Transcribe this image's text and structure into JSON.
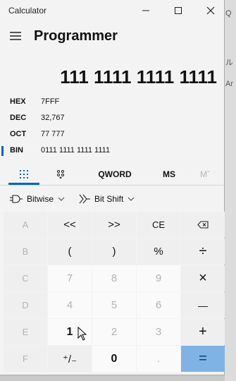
{
  "window": {
    "title": "Calculator"
  },
  "header": {
    "mode_title": "Programmer"
  },
  "display": {
    "value": "111 1111 1111 1111"
  },
  "radix": [
    {
      "label": "HEX",
      "value": "7FFF",
      "selected": false
    },
    {
      "label": "DEC",
      "value": "32,767",
      "selected": false
    },
    {
      "label": "OCT",
      "value": "77 777",
      "selected": false
    },
    {
      "label": "BIN",
      "value": "0111 1111 1111 1111",
      "selected": true
    }
  ],
  "tabs": {
    "qword": "QWORD",
    "ms": "MS",
    "mplus": "Mˇ"
  },
  "bitrow": {
    "bitwise": "Bitwise",
    "bitshift": "Bit Shift"
  },
  "keys": [
    [
      "A",
      "<<",
      ">>",
      "CE",
      "⌫"
    ],
    [
      "B",
      "(",
      ")",
      "%",
      "÷"
    ],
    [
      "C",
      "7",
      "8",
      "9",
      "×"
    ],
    [
      "D",
      "4",
      "5",
      "6",
      "—"
    ],
    [
      "E",
      "1",
      "2",
      "3",
      "+"
    ],
    [
      "F",
      "⁺/₋",
      "0",
      ".",
      "="
    ]
  ],
  "background_text": {
    "line1": "Q",
    "line2": "ル",
    "line3": "Ar"
  },
  "colors": {
    "accent": "#0067c0",
    "equals_bg": "#7fb3e6"
  }
}
